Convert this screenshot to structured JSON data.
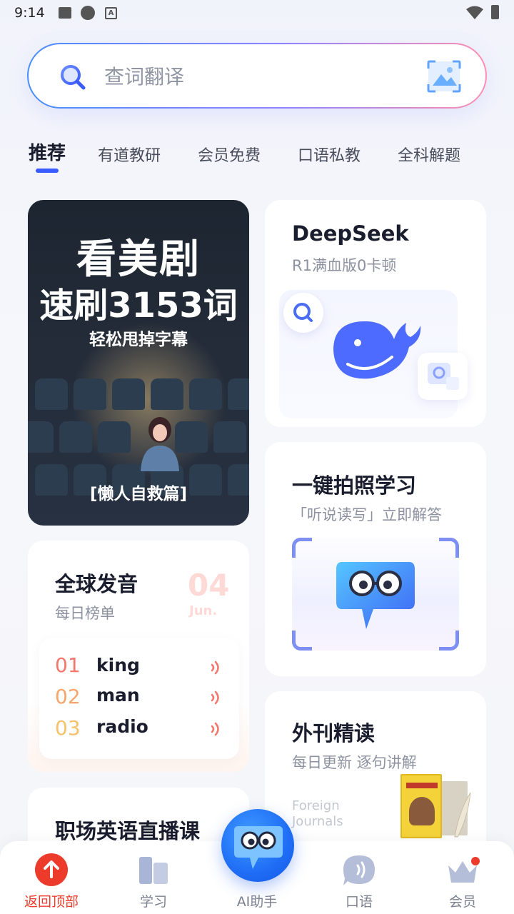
{
  "status_bar": {
    "time": "9:14"
  },
  "search": {
    "placeholder": "查词翻译"
  },
  "tabs": [
    {
      "label": "推荐",
      "active": true
    },
    {
      "label": "有道教研",
      "active": false
    },
    {
      "label": "会员免费",
      "active": false
    },
    {
      "label": "口语私教",
      "active": false
    },
    {
      "label": "全科解题",
      "active": false
    }
  ],
  "banner": {
    "line1": "看美剧",
    "line2": "速刷3153词",
    "line3": "轻松甩掉字幕",
    "line4": "[懒人自救篇]"
  },
  "deepseek": {
    "title": "DeepSeek",
    "subtitle": "R1满血版0卡顿"
  },
  "pronunciation": {
    "title": "全球发音",
    "subtitle": "每日榜单",
    "date_day": "04",
    "date_month": "Jun.",
    "items": [
      {
        "rank": "01",
        "word": "king"
      },
      {
        "rank": "02",
        "word": "man"
      },
      {
        "rank": "03",
        "word": "radio"
      }
    ]
  },
  "photo_learning": {
    "title": "一键拍照学习",
    "subtitle": "「听说读写」立即解答"
  },
  "foreign_journals": {
    "title": "外刊精读",
    "subtitle": "每日更新 逐句讲解",
    "en_line1": "Foreign",
    "en_line2": "Journals"
  },
  "career_course": {
    "title": "职场英语直播课"
  },
  "bottom_nav": {
    "back_to_top": "返回顶部",
    "study": "学习",
    "ai_assistant": "AI助手",
    "speaking": "口语",
    "membership": "会员"
  },
  "colors": {
    "accent_blue": "#3a5bff",
    "rank1": "#f4776b",
    "rank2": "#f6a56b",
    "rank3": "#f5c26b",
    "red": "#ec3b2a"
  }
}
